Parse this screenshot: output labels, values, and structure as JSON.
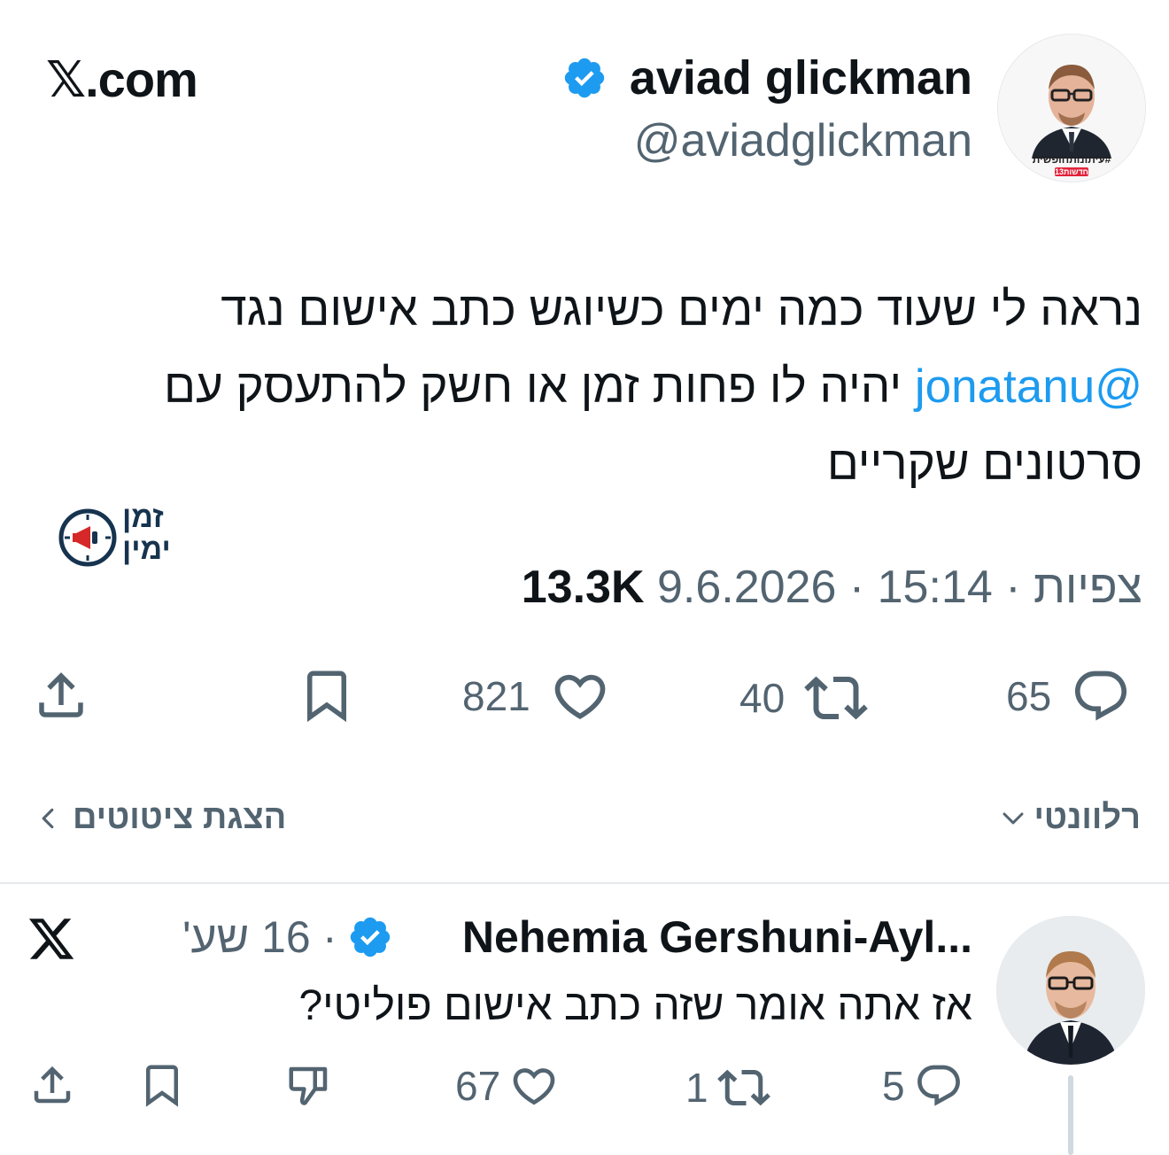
{
  "header": {
    "site_label": "𝕏.com",
    "author_name": "aviad glickman",
    "author_handle": "@aviadglickman",
    "avatar_caption": "#עיתונותחופשית",
    "avatar_badge": "חדשות13"
  },
  "tweet": {
    "line1": "נראה לי שעוד כמה ימים כשיוגש כתב אישום נגד",
    "mention": "@jonatanu",
    "line2_rest": "יהיה לו פחות זמן או חשק להתעסק עם",
    "line3": "סרטונים שקריים",
    "brand_logo_text_1": "זמן",
    "brand_logo_text_2": "ימין",
    "date": "9.6.2026",
    "time": "15:14",
    "views_label": "צפיות",
    "views_count": "13.3K",
    "sep": "·"
  },
  "actions": {
    "likes": "821",
    "reposts": "40",
    "replies": "65"
  },
  "sort": {
    "relevant_label": "רלוונטי",
    "show_quotes_label": "הצגת ציטוטים"
  },
  "reply": {
    "name": "Nehemia Gershuni-Ayl...",
    "sep": "·",
    "time": "16 שע'",
    "text": "אז אתה אומר שזה כתב אישום פוליטי?",
    "likes": "67",
    "reposts": "1",
    "replies": "5"
  },
  "colors": {
    "accent": "#1d9bf0",
    "text": "#0f1419",
    "muted": "#536471",
    "divider": "#e6e9ec"
  },
  "icons": [
    "x-logo-icon",
    "verified-badge-icon",
    "share-icon",
    "bookmark-icon",
    "heart-icon",
    "repost-icon",
    "reply-icon",
    "chevron-down-icon",
    "chevron-left-icon",
    "dislike-icon"
  ]
}
